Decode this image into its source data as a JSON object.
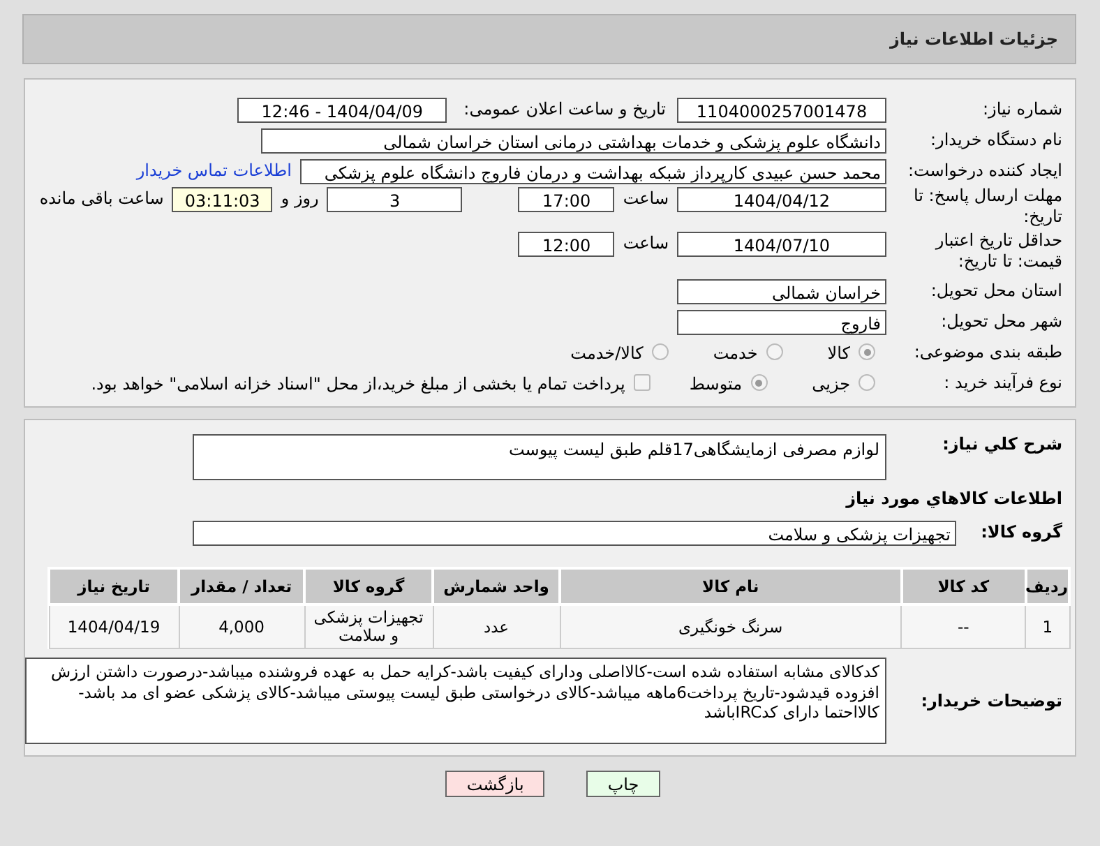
{
  "header": {
    "title": "جزئیات اطلاعات نیاز"
  },
  "need_number": {
    "label": "شماره نیاز:",
    "value": "1104000257001478"
  },
  "announce": {
    "label": "تاریخ و ساعت اعلان عمومی:",
    "value": "1404/04/09 - 12:46"
  },
  "buyer_org": {
    "label": "نام دستگاه خریدار:",
    "value": "دانشگاه علوم پزشکی و خدمات بهداشتی درمانی استان خراسان شمالی"
  },
  "creator": {
    "label": "ایجاد کننده درخواست:",
    "value": "محمد حسن عبیدی کارپرداز شبکه بهداشت و درمان فاروج دانشگاه علوم پزشکی",
    "link": "اطلاعات تماس خریدار"
  },
  "deadline": {
    "label": "مهلت ارسال پاسخ: تا تاریخ:",
    "date": "1404/04/12",
    "time_label": "ساعت",
    "time": "17:00",
    "days": "3",
    "days_label": "روز و",
    "remaining": "03:11:03",
    "remaining_label": "ساعت باقی مانده"
  },
  "validity": {
    "label": "حداقل تاریخ اعتبار قیمت: تا تاریخ:",
    "date": "1404/07/10",
    "time_label": "ساعت",
    "time": "12:00"
  },
  "province": {
    "label": "استان محل تحویل:",
    "value": "خراسان شمالی"
  },
  "city": {
    "label": "شهر محل تحویل:",
    "value": "فاروج"
  },
  "category": {
    "label": "طبقه بندی موضوعی:",
    "options": [
      {
        "label": "کالا",
        "selected": true
      },
      {
        "label": "خدمت",
        "selected": false
      },
      {
        "label": "کالا/خدمت",
        "selected": false
      }
    ]
  },
  "process": {
    "label": "نوع فرآیند خرید :",
    "options": [
      {
        "label": "جزیی",
        "selected": false
      },
      {
        "label": "متوسط",
        "selected": true
      }
    ],
    "payment_check": {
      "label": "پرداخت تمام یا بخشی از مبلغ خرید،از محل \"اسناد خزانه اسلامی\" خواهد بود.",
      "checked": false
    }
  },
  "description": {
    "label": "شرح کلي نياز:",
    "value": "لوازم مصرفی ازمایشگاهی17قلم طبق لیست پیوست"
  },
  "goods_section": {
    "title": "اطلاعات کالاهاي مورد نياز"
  },
  "goods_group": {
    "label": "گروه کالا:",
    "value": "تجهیزات پزشکی و سلامت"
  },
  "table": {
    "columns": [
      "ردیف",
      "کد کالا",
      "نام کالا",
      "واحد شمارش",
      "گروه کالا",
      "تعداد / مقدار",
      "تاریخ نیاز"
    ],
    "rows": [
      [
        "1",
        "--",
        "سرنگ خونگیری",
        "عدد",
        "تجهیزات پزشکی و سلامت",
        "4,000",
        "1404/04/19"
      ]
    ]
  },
  "buyer_notes": {
    "label": "توضیحات خریدار:",
    "value": "کدکالای مشابه استفاده شده است-کالااصلی ودارای کیفیت باشد-کرایه حمل به عهده فروشنده میباشد-درصورت داشتن ارزش افزوده قیدشود-تاریخ پرداخت6ماهه میباشد-کالای درخواستی طبق لیست پیوستی میباشد-کالای پزشکی عضو ای مد باشد-کالااحتما دارای کدIRCباشد"
  },
  "buttons": [
    {
      "label": "چاپ",
      "kind": "print"
    },
    {
      "label": "بازگشت",
      "kind": "back"
    }
  ]
}
